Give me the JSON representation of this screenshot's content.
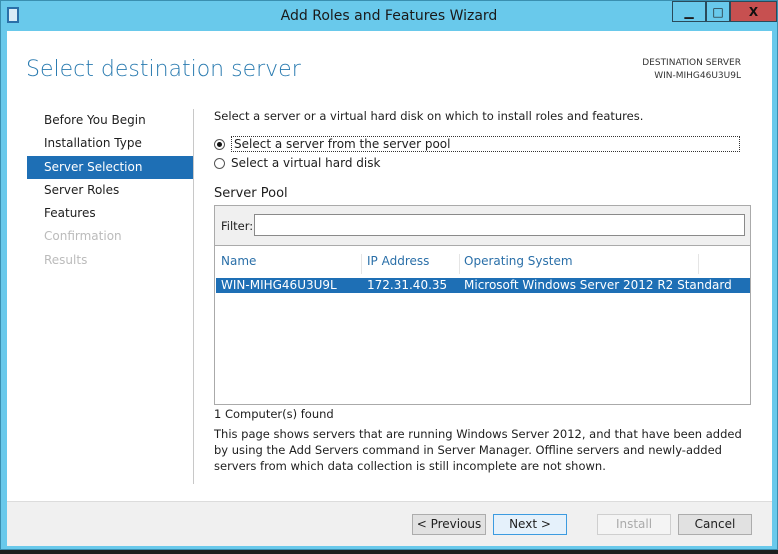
{
  "window": {
    "title": "Add Roles and Features Wizard",
    "minimize": "▁",
    "maximize": "□",
    "close": "X"
  },
  "header": {
    "title": "Select destination server",
    "dest_label": "DESTINATION SERVER",
    "dest_value": "WIN-MIHG46U3U9L"
  },
  "nav": [
    {
      "label": "Before You Begin",
      "state": "normal"
    },
    {
      "label": "Installation Type",
      "state": "normal"
    },
    {
      "label": "Server Selection",
      "state": "active"
    },
    {
      "label": "Server Roles",
      "state": "normal"
    },
    {
      "label": "Features",
      "state": "normal"
    },
    {
      "label": "Confirmation",
      "state": "disabled"
    },
    {
      "label": "Results",
      "state": "disabled"
    }
  ],
  "main": {
    "intro": "Select a server or a virtual hard disk on which to install roles and features.",
    "radio_pool": "Select a server from the server pool",
    "radio_vhd": "Select a virtual hard disk",
    "pool_title": "Server Pool",
    "filter_label": "Filter:",
    "filter_value": "",
    "columns": [
      "Name",
      "IP Address",
      "Operating System"
    ],
    "rows": [
      {
        "name": "WIN-MIHG46U3U9L",
        "ip": "172.31.40.35",
        "os": "Microsoft Windows Server 2012 R2 Standard"
      }
    ],
    "found": "1 Computer(s) found",
    "description": "This page shows servers that are running Windows Server 2012, and that have been added by using the Add Servers command in Server Manager. Offline servers and newly-added servers from which data collection is still incomplete are not shown."
  },
  "buttons": {
    "previous": "< Previous",
    "next": "Next >",
    "install": "Install",
    "cancel": "Cancel"
  }
}
